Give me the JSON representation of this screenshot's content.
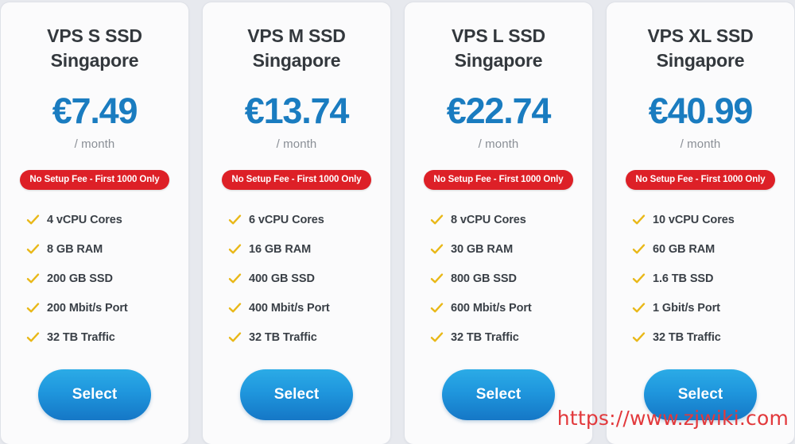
{
  "page": {
    "background_color": "#e7e9ee",
    "watermark": "https://www.zjwiki.com",
    "watermark_color": "#e2393c"
  },
  "theme": {
    "card_background": "#fbfbfc",
    "price_color": "#1a7cc0",
    "badge_color": "#dd2027",
    "check_color": "#e9b818",
    "button_color": "#1f96dd",
    "title_color": "#33383d"
  },
  "plans": [
    {
      "title": "VPS S SSD",
      "location": "Singapore",
      "price": "€7.49",
      "period": "/ month",
      "badge": "No Setup Fee - First 1000 Only",
      "features": [
        "4 vCPU Cores",
        "8 GB RAM",
        "200 GB SSD",
        "200 Mbit/s Port",
        "32 TB Traffic"
      ],
      "cta": "Select"
    },
    {
      "title": "VPS M SSD",
      "location": "Singapore",
      "price": "€13.74",
      "period": "/ month",
      "badge": "No Setup Fee - First 1000 Only",
      "features": [
        "6 vCPU Cores",
        "16 GB RAM",
        "400 GB SSD",
        "400 Mbit/s Port",
        "32 TB Traffic"
      ],
      "cta": "Select"
    },
    {
      "title": "VPS L SSD",
      "location": "Singapore",
      "price": "€22.74",
      "period": "/ month",
      "badge": "No Setup Fee - First 1000 Only",
      "features": [
        "8 vCPU Cores",
        "30 GB RAM",
        "800 GB SSD",
        "600 Mbit/s Port",
        "32 TB Traffic"
      ],
      "cta": "Select"
    },
    {
      "title": "VPS XL SSD",
      "location": "Singapore",
      "price": "€40.99",
      "period": "/ month",
      "badge": "No Setup Fee - First 1000 Only",
      "features": [
        "10 vCPU Cores",
        "60 GB RAM",
        "1.6 TB SSD",
        "1 Gbit/s Port",
        "32 TB Traffic"
      ],
      "cta": "Select"
    }
  ]
}
